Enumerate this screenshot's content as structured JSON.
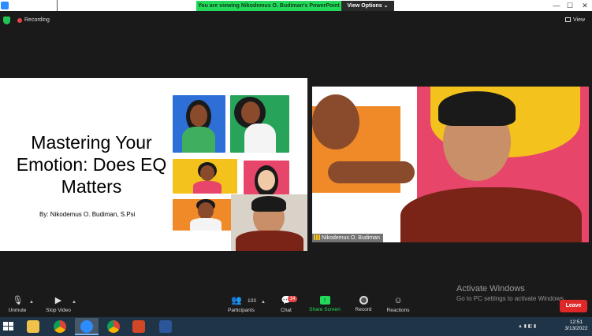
{
  "window": {
    "banner": "You are viewing Nikodemus O. Budiman's PowerPoint",
    "view_options": "View Options ⌄",
    "minimize": "—",
    "maximize": "☐",
    "close": "✕"
  },
  "recording": {
    "label": "Recording"
  },
  "view_button": {
    "label": "View"
  },
  "slide": {
    "title_lines": [
      "Mastering Your",
      "Emotion: Does EQ",
      "Matters"
    ],
    "byline": "By: Nikodemus O. Budiman, S.Psi"
  },
  "speaker": {
    "name": "Nikodemus O. Budiman"
  },
  "watermark": {
    "title": "Activate Windows",
    "subtitle": "Go to PC settings to activate Windows."
  },
  "toolbar": {
    "unmute": "Unmute",
    "stop_video": "Stop Video",
    "participants": "Participants",
    "participants_count": "103",
    "chat": "Chat",
    "chat_badge": "14",
    "share_screen": "Share Screen",
    "record": "Record",
    "reactions": "Reactions",
    "leave": "Leave"
  },
  "taskbar": {
    "clock_time": "12:51",
    "clock_date": "3/13/2022"
  },
  "colors": {
    "banner_green": "#23d959",
    "leave_red": "#e02828",
    "taskbar": "#1f3447"
  }
}
